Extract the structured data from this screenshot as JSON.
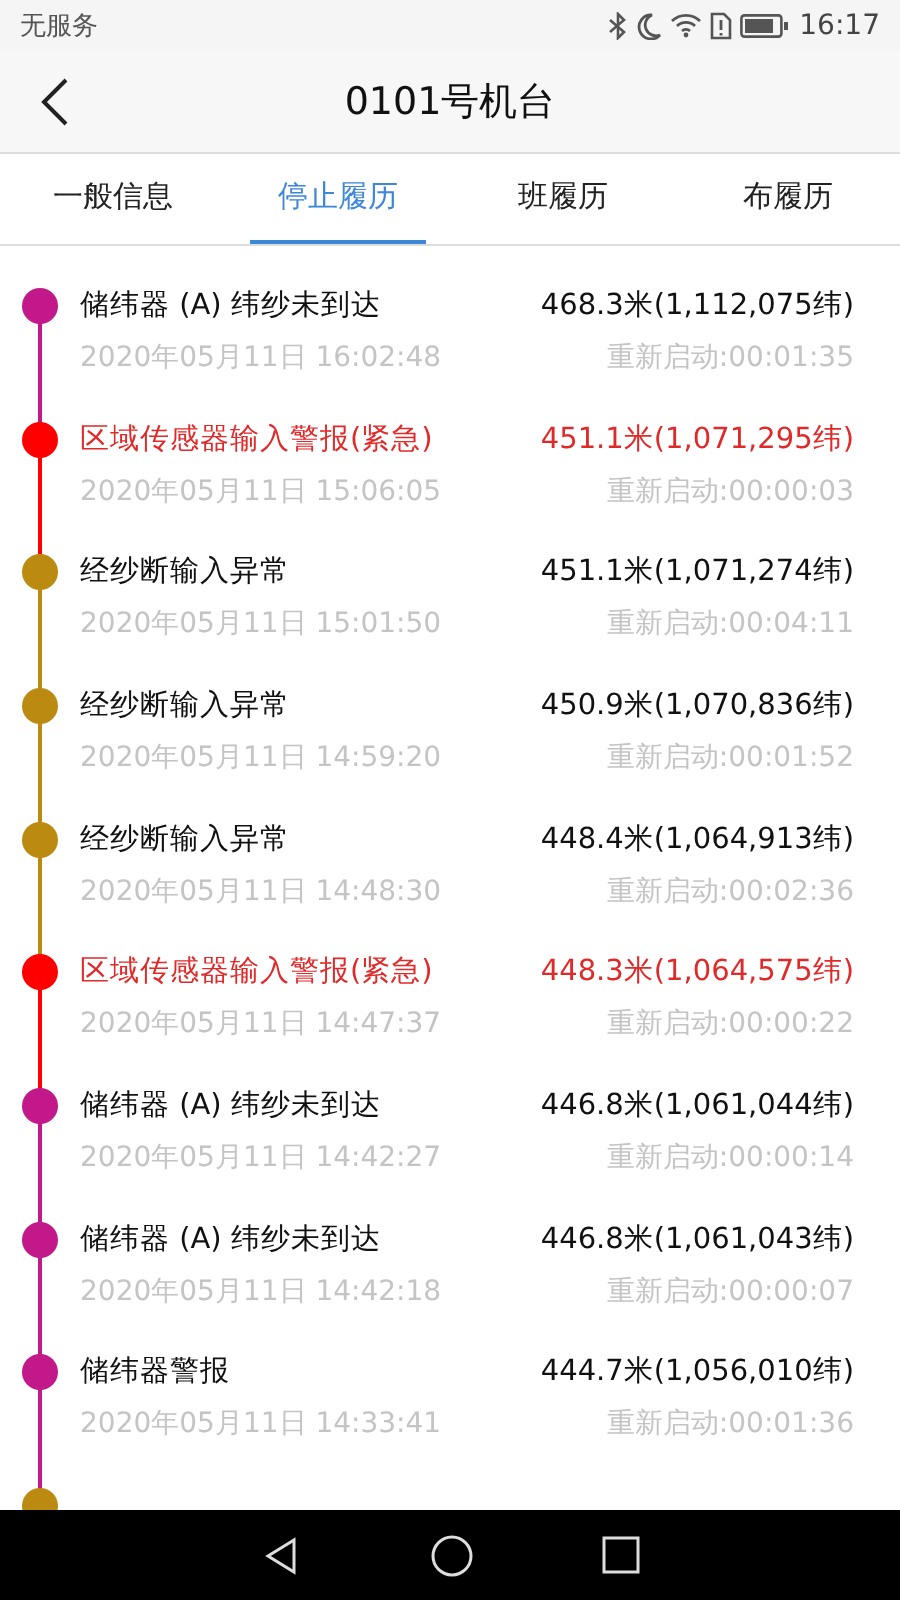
{
  "status_bar": {
    "carrier": "无服务",
    "time": "16:17"
  },
  "header": {
    "title": "0101号机台"
  },
  "tabs": [
    {
      "label": "一般信息",
      "selected": false
    },
    {
      "label": "停止履历",
      "selected": true
    },
    {
      "label": "班履历",
      "selected": false
    },
    {
      "label": "布履历",
      "selected": false
    }
  ],
  "events": [
    {
      "name": "储纬器 (A) 纬纱未到达",
      "length": "468.3米(1,112,075纬)",
      "time": "2020年05月11日 16:02:48",
      "restart": "重新启动:00:01:35",
      "color": "#c2188a",
      "urgent": false
    },
    {
      "name": "区域传感器输入警报(紧急)",
      "length": "451.1米(1,071,295纬)",
      "time": "2020年05月11日 15:06:05",
      "restart": "重新启动:00:00:03",
      "color": "#ff0000",
      "urgent": true
    },
    {
      "name": "经纱断输入异常",
      "length": "451.1米(1,071,274纬)",
      "time": "2020年05月11日 15:01:50",
      "restart": "重新启动:00:04:11",
      "color": "#bb8a10",
      "urgent": false
    },
    {
      "name": "经纱断输入异常",
      "length": "450.9米(1,070,836纬)",
      "time": "2020年05月11日 14:59:20",
      "restart": "重新启动:00:01:52",
      "color": "#bb8a10",
      "urgent": false
    },
    {
      "name": "经纱断输入异常",
      "length": "448.4米(1,064,913纬)",
      "time": "2020年05月11日 14:48:30",
      "restart": "重新启动:00:02:36",
      "color": "#bb8a10",
      "urgent": false
    },
    {
      "name": "区域传感器输入警报(紧急)",
      "length": "448.3米(1,064,575纬)",
      "time": "2020年05月11日 14:47:37",
      "restart": "重新启动:00:00:22",
      "color": "#ff0000",
      "urgent": true
    },
    {
      "name": "储纬器 (A) 纬纱未到达",
      "length": "446.8米(1,061,044纬)",
      "time": "2020年05月11日 14:42:27",
      "restart": "重新启动:00:00:14",
      "color": "#c2188a",
      "urgent": false
    },
    {
      "name": "储纬器 (A) 纬纱未到达",
      "length": "446.8米(1,061,043纬)",
      "time": "2020年05月11日 14:42:18",
      "restart": "重新启动:00:00:07",
      "color": "#c2188a",
      "urgent": false
    },
    {
      "name": "储纬器警报",
      "length": "444.7米(1,056,010纬)",
      "time": "2020年05月11日 14:33:41",
      "restart": "重新启动:00:01:36",
      "color": "#c2188a",
      "urgent": false
    },
    {
      "color": "#bb8a10"
    }
  ]
}
